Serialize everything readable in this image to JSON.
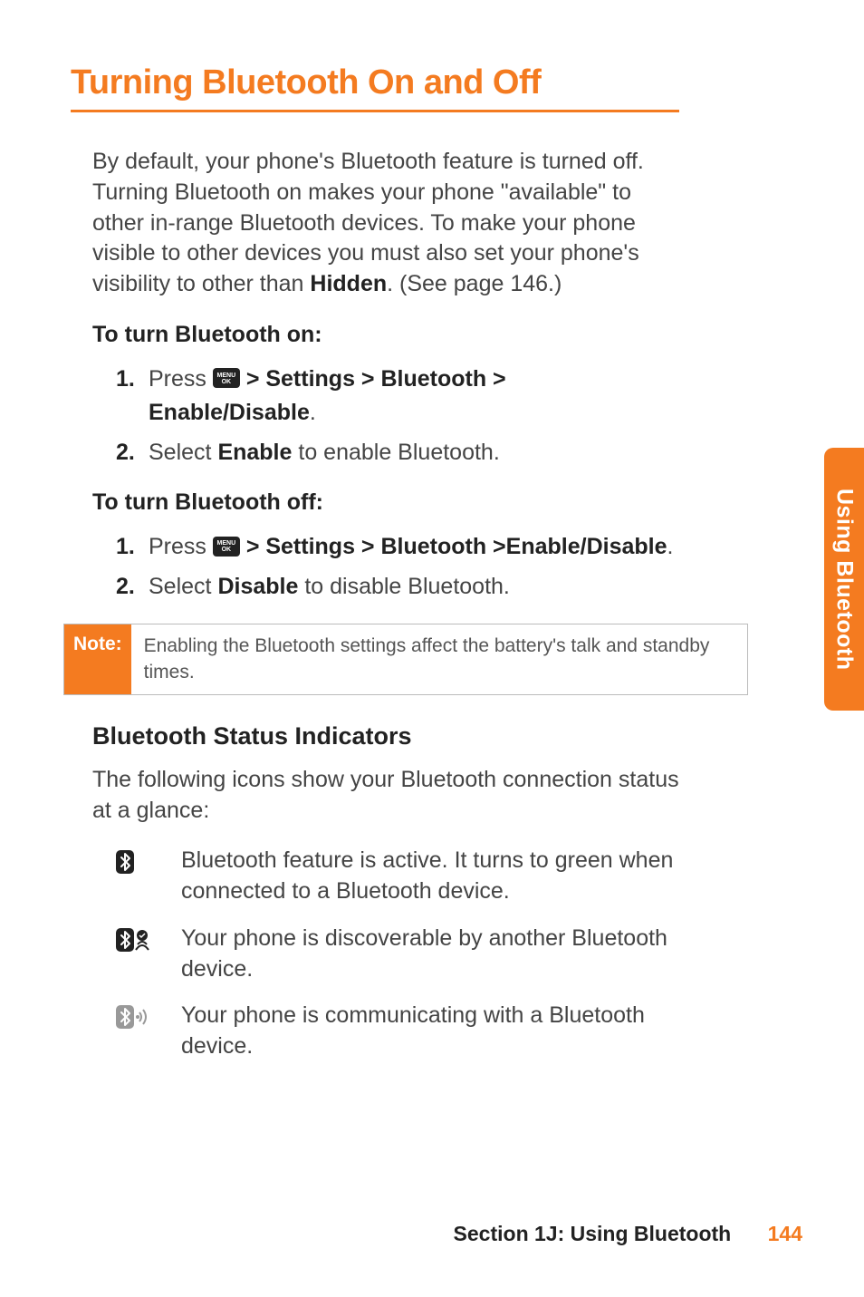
{
  "title": "Turning Bluetooth On and Off",
  "intro_parts": {
    "a": "By default, your phone's Bluetooth feature is turned off. Turning Bluetooth on makes your phone \"available\" to other in-range Bluetooth devices. To make your phone visible to other devices you must also set your phone's visibility to other than ",
    "b": "Hidden",
    "c": ". (See page 146.)"
  },
  "turn_on": {
    "heading": "To turn Bluetooth on:",
    "s1": {
      "num": "1.",
      "a": "Press ",
      "b": " > Settings > Bluetooth > Enable/Disable",
      "c": "."
    },
    "s2": {
      "num": "2.",
      "a": "Select ",
      "b": "Enable",
      "c": " to enable Bluetooth."
    }
  },
  "turn_off": {
    "heading": "To turn Bluetooth off:",
    "s1": {
      "num": "1.",
      "a": "Press ",
      "b": " > Settings > Bluetooth >Enable/Disable",
      "c": "."
    },
    "s2": {
      "num": "2.",
      "a": "Select ",
      "b": "Disable",
      "c": " to disable Bluetooth."
    }
  },
  "note": {
    "label": "Note:",
    "text": "Enabling the Bluetooth settings affect the battery's talk and standby times."
  },
  "indicators": {
    "heading": "Bluetooth Status Indicators",
    "intro": "The following icons show your Bluetooth connection status at a glance:",
    "i1": "Bluetooth feature is active. It turns to green when connected to a Bluetooth device.",
    "i2": "Your phone is discoverable by another Bluetooth device.",
    "i3": "Your phone is communicating with a Bluetooth device."
  },
  "menu_icon": {
    "top": "MENU",
    "bot": "OK"
  },
  "side_tab": "Using Bluetooth",
  "footer": {
    "section": "Section 1J: Using Bluetooth",
    "page": "144"
  }
}
